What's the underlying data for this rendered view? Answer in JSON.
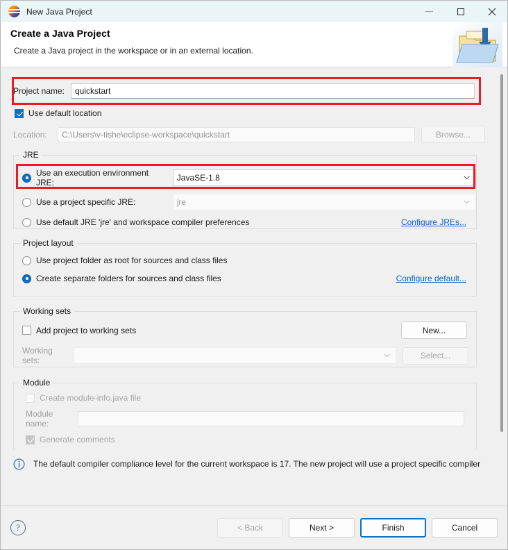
{
  "window": {
    "title": "New Java Project",
    "logo_icon": "eclipse-logo-icon",
    "minimize_label": "minimize-icon",
    "maximize_label": "maximize-icon",
    "close_label": "close-icon"
  },
  "banner": {
    "title": "Create a Java Project",
    "description": "Create a Java project in the workspace or in an external location.",
    "icon": "folder-import-icon"
  },
  "project": {
    "name_label": "Project name:",
    "name_value": "quickstart",
    "name_placeholder": "",
    "use_default_location_label": "Use default location",
    "use_default_location_checked": true,
    "location_label": "Location:",
    "location_value": "C:\\Users\\v-tishe\\eclipse-workspace\\quickstart",
    "browse_label": "Browse..."
  },
  "jre": {
    "group_label": "JRE",
    "option_execution_env_label": "Use an execution environment JRE:",
    "option_execution_env_selected": true,
    "execution_env_value": "JavaSE-1.8",
    "option_project_specific_label": "Use a project specific JRE:",
    "option_project_specific_selected": false,
    "project_specific_value": "jre",
    "option_default_jre_label": "Use default JRE 'jre' and workspace compiler preferences",
    "option_default_jre_selected": false,
    "configure_link": "Configure JREs..."
  },
  "project_layout": {
    "group_label": "Project layout",
    "option_root_label": "Use project folder as root for sources and class files",
    "option_root_selected": false,
    "option_separate_label": "Create separate folders for sources and class files",
    "option_separate_selected": true,
    "configure_link": "Configure default..."
  },
  "working_sets": {
    "group_label": "Working sets",
    "add_project_label": "Add project to working sets",
    "add_project_checked": false,
    "new_label": "New...",
    "working_sets_label": "Working sets:",
    "working_sets_value": "",
    "select_label": "Select..."
  },
  "module": {
    "group_label": "Module",
    "create_module_info_label": "Create module-info.java file",
    "create_module_info_checked": false,
    "module_name_label": "Module name:",
    "module_name_value": "",
    "generate_comments_label": "Generate comments",
    "generate_comments_checked": true
  },
  "status": {
    "icon": "info-icon",
    "message": "The default compiler compliance level for the current workspace is 17. The new project will use a project specific compiler"
  },
  "footer": {
    "help_icon": "help-icon",
    "back_label": "< Back",
    "back_disabled": true,
    "next_label": "Next >",
    "finish_label": "Finish",
    "cancel_label": "Cancel"
  },
  "colors": {
    "titlebar": "#e9f5f7",
    "accent": "#0b6fc4",
    "link": "#0b5fc4",
    "annotation": "#ec1c24",
    "dialog_bg": "#f0f0f0"
  }
}
